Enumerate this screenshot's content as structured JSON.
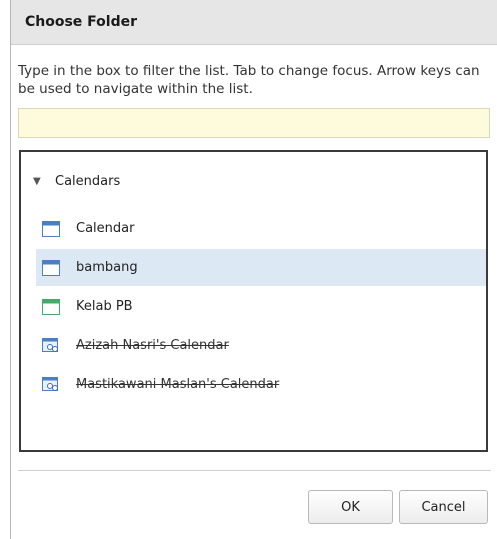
{
  "dialog": {
    "title": "Choose Folder",
    "instructions": "Type in the box to filter the list. Tab to change focus. Arrow keys can be used to navigate within the list.",
    "filter_value": ""
  },
  "tree": {
    "root": {
      "label": "Calendars",
      "icon": "expanded-triangle-icon"
    },
    "items": [
      {
        "label": "Calendar",
        "icon": "calendar-icon",
        "selected": false,
        "disabled": false
      },
      {
        "label": "bambang",
        "icon": "calendar-icon",
        "selected": true,
        "disabled": false
      },
      {
        "label": "Kelab PB",
        "icon": "calendar-green-icon",
        "selected": false,
        "disabled": false
      },
      {
        "label": "Azizah Nasri's Calendar",
        "icon": "shared-calendar-icon",
        "selected": false,
        "disabled": true
      },
      {
        "label": "Mastikawani Maslan's Calendar",
        "icon": "shared-calendar-icon",
        "selected": false,
        "disabled": true
      }
    ]
  },
  "buttons": {
    "ok": "OK",
    "cancel": "Cancel"
  },
  "colors": {
    "title_bar": "#e6e6e6",
    "filter_bg": "#fdfbdc",
    "selected_row": "#dce8f3"
  }
}
